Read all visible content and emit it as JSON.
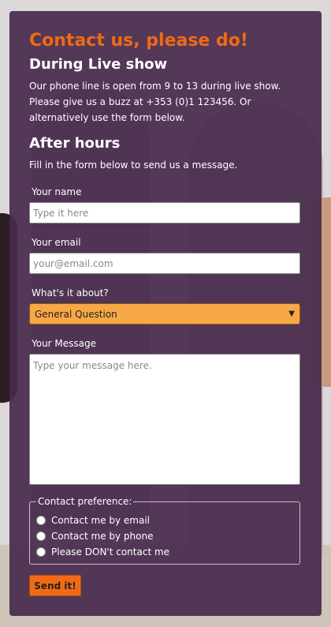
{
  "contact": {
    "title": "Contact us, please do!",
    "live_heading": "During Live show",
    "live_text": "Our phone line is open from 9 to 13 during live show. Please give us a buzz at +353 (0)1 123456. Or alternatively use the form below.",
    "after_heading": "After hours",
    "after_text": "Fill in the form below to send us a message."
  },
  "form": {
    "name_label": "Your name",
    "name_placeholder": "Type it here",
    "email_label": "Your email",
    "email_placeholder": "your@email.com",
    "about_label": "What's it about?",
    "about_selected": "General Question",
    "message_label": "Your Message",
    "message_placeholder": "Type your message here.",
    "preference_legend": "Contact preference:",
    "preferences": [
      {
        "label": "Contact me by email"
      },
      {
        "label": "Contact me by phone"
      },
      {
        "label": "Please DON't contact me"
      }
    ],
    "send_label": "Send it!"
  },
  "colors": {
    "accent": "#f06a16",
    "panel": "#472a4c",
    "select_bg": "#f7a846"
  }
}
